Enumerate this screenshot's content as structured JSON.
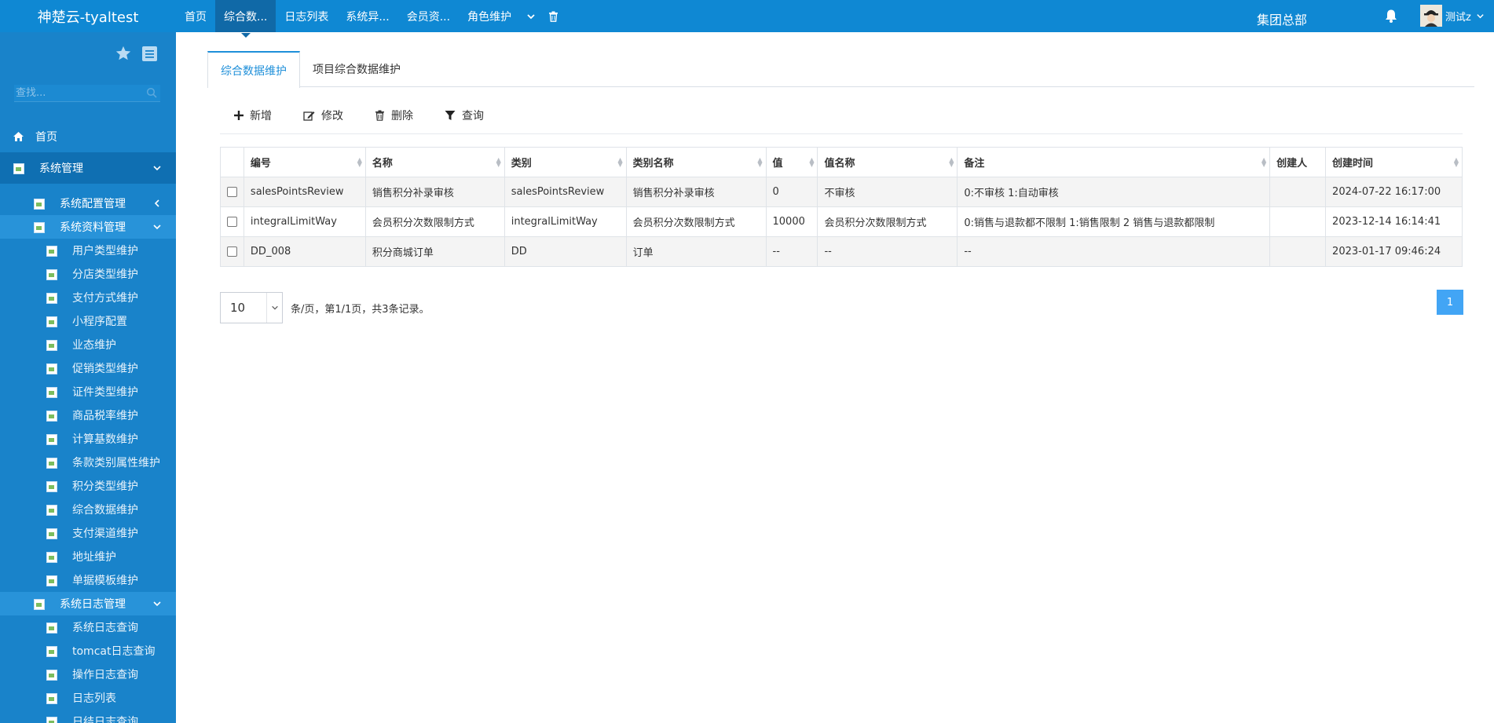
{
  "app": {
    "brand": "神楚云-tyaltest"
  },
  "topnav": {
    "items": [
      {
        "label": "首页",
        "active": false
      },
      {
        "label": "综合数...",
        "active": true
      },
      {
        "label": "日志列表",
        "active": false
      },
      {
        "label": "系统异...",
        "active": false
      },
      {
        "label": "会员资...",
        "active": false
      },
      {
        "label": "角色维护",
        "active": false
      }
    ],
    "org": "集团总部",
    "user": "测试z"
  },
  "sidebar": {
    "search_placeholder": "查找...",
    "home": "首页",
    "system_mgmt": "系统管理",
    "config_mgmt": "系统配置管理",
    "data_mgmt": "系统资料管理",
    "data_items": [
      "用户类型维护",
      "分店类型维护",
      "支付方式维护",
      "小程序配置",
      "业态维护",
      "促销类型维护",
      "证件类型维护",
      "商品税率维护",
      "计算基数维护",
      "条款类别属性维护",
      "积分类型维护",
      "综合数据维护",
      "支付渠道维护",
      "地址维护",
      "单据模板维护"
    ],
    "log_mgmt": "系统日志管理",
    "log_items": [
      "系统日志查询",
      "tomcat日志查询",
      "操作日志查询",
      "日志列表",
      "日结日志查询"
    ]
  },
  "tabs": [
    {
      "label": "综合数据维护",
      "active": true
    },
    {
      "label": "项目综合数据维护",
      "active": false
    }
  ],
  "toolbar": {
    "add": "新增",
    "edit": "修改",
    "delete": "删除",
    "query": "查询"
  },
  "table": {
    "columns": [
      "编号",
      "名称",
      "类别",
      "类别名称",
      "值",
      "值名称",
      "备注",
      "创建人",
      "创建时间"
    ],
    "rows": [
      [
        "salesPointsReview",
        "销售积分补录审核",
        "salesPointsReview",
        "销售积分补录审核",
        "0",
        "不审核",
        "0:不审核 1:自动审核",
        "",
        "2024-07-22 16:17:00"
      ],
      [
        "integralLimitWay",
        "会员积分次数限制方式",
        "integralLimitWay",
        "会员积分次数限制方式",
        "10000",
        "会员积分次数限制方式",
        "0:销售与退款都不限制 1:销售限制 2 销售与退款都限制",
        "",
        "2023-12-14 16:14:41"
      ],
      [
        "DD_008",
        "积分商城订单",
        "DD",
        "订单",
        "--",
        "--",
        "--",
        "",
        "2023-01-17 09:46:24"
      ]
    ]
  },
  "pager": {
    "page_size": "10",
    "info": "条/页，第1/1页，共3条记录。",
    "current": "1"
  }
}
